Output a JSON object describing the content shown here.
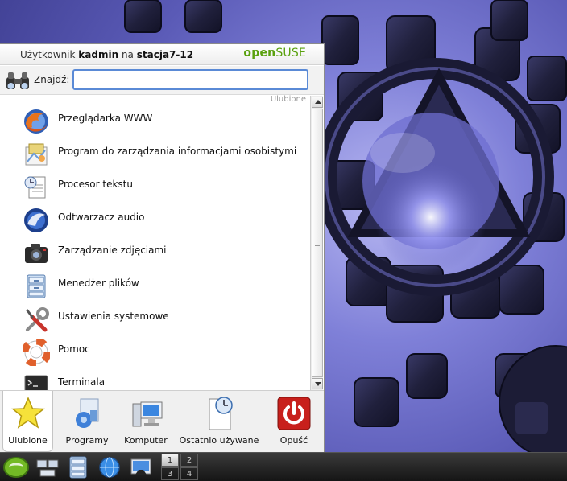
{
  "menu": {
    "header": {
      "user_prefix": "Użytkownik",
      "username": "kadmin",
      "on_text": "na",
      "host": "stacja7-12",
      "brand_open": "open",
      "brand_suse": "SUSE"
    },
    "search": {
      "label": "Znajdź:",
      "value": "",
      "placeholder": ""
    },
    "section_title": "Ulubione",
    "items": [
      {
        "label": "Przeglądarka WWW",
        "icon": "firefox-icon"
      },
      {
        "label": "Program do zarządzania informacjami osobistymi",
        "icon": "pim-icon"
      },
      {
        "label": "Procesor tekstu",
        "icon": "word-processor-icon"
      },
      {
        "label": "Odtwarzacz audio",
        "icon": "audio-player-icon"
      },
      {
        "label": "Zarządzanie zdjęciami",
        "icon": "camera-icon"
      },
      {
        "label": "Menedżer plików",
        "icon": "file-manager-icon"
      },
      {
        "label": "Ustawienia systemowe",
        "icon": "system-settings-icon"
      },
      {
        "label": "Pomoc",
        "icon": "help-lifebuoy-icon"
      },
      {
        "label": "Terminala",
        "icon": "terminal-icon"
      }
    ],
    "tabs": [
      {
        "label": "Ulubione",
        "icon": "star-icon",
        "active": true
      },
      {
        "label": "Programy",
        "icon": "applications-icon",
        "active": false
      },
      {
        "label": "Komputer",
        "icon": "computer-icon",
        "active": false
      },
      {
        "label": "Ostatnio używane",
        "icon": "recent-documents-icon",
        "active": false
      },
      {
        "label": "Opuść",
        "icon": "power-icon",
        "active": false
      }
    ]
  },
  "taskbar": {
    "pager": [
      "1",
      "2",
      "3",
      "4"
    ],
    "active_desktop": "1"
  },
  "colors": {
    "brand_green": "#5aa10e",
    "search_focus": "#5a8ad6",
    "wallpaper": "#6f70cc"
  }
}
